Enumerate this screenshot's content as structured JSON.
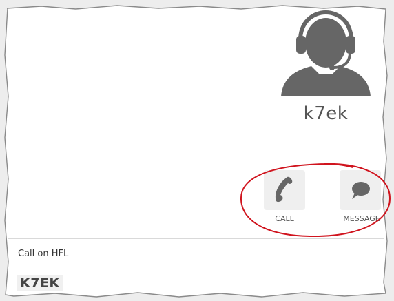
{
  "contact": {
    "avatar_icon": "user-headset-icon",
    "username": "k7ek"
  },
  "actions": {
    "call": {
      "icon": "phone-icon",
      "label": "CALL"
    },
    "message": {
      "icon": "speech-bubble-icon",
      "label": "MESSAGE"
    }
  },
  "call_section": {
    "heading": "Call on HFL",
    "callsign": "K7EK"
  },
  "colors": {
    "icon_gray": "#666666",
    "button_bg": "#efefef",
    "highlight_red": "#d0141e"
  }
}
